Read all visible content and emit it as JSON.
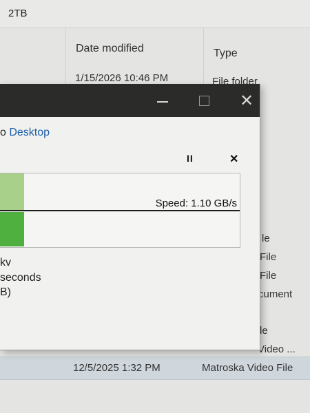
{
  "explorer": {
    "tab_title": "2TB",
    "columns": {
      "date_modified": "Date modified",
      "type": "Type"
    },
    "rows": [
      {
        "date": "1/15/2026 10:46 PM",
        "type": "File folder"
      }
    ],
    "partial_types": [
      "le",
      "File",
      "File",
      "cument",
      "le",
      "Video ..."
    ],
    "selected_row": {
      "date": "12/5/2025 1:32 PM",
      "type": "Matroska Video File"
    }
  },
  "dialog": {
    "title_buttons": {
      "minimize": "—",
      "maximize": "☐",
      "close": "✕"
    },
    "destination_prefix": "o ",
    "destination_link": "Desktop",
    "pause_label": "II",
    "cancel_label": "✕",
    "speed_text": "Speed: 1.10 GB/s",
    "progress_fraction": 0.1,
    "details": [
      "kv",
      "seconds",
      "B)"
    ],
    "colors": {
      "progress_light": "#a9d08a",
      "progress_dark": "#4fb040",
      "titlebar": "#2b2b2a",
      "link": "#1f5fa8"
    }
  }
}
